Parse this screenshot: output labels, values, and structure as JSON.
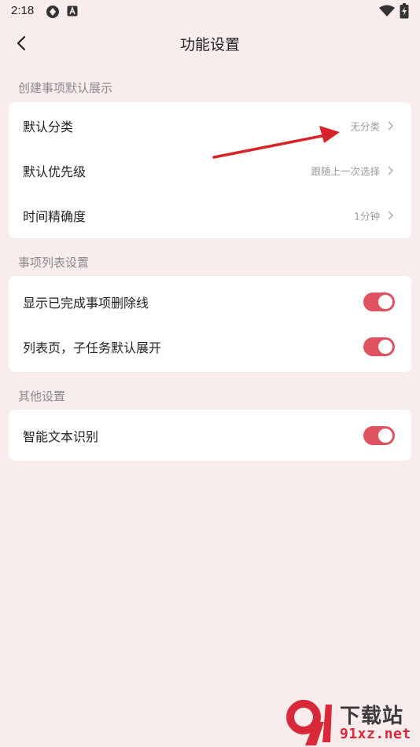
{
  "status_bar": {
    "time": "2:18",
    "icons": [
      "sync-icon",
      "a-badge-icon",
      "wifi-icon",
      "battery-charging-icon"
    ]
  },
  "header": {
    "title": "功能设置",
    "back_icon": "chevron-left-icon"
  },
  "sections": [
    {
      "title": "创建事项默认展示",
      "items": [
        {
          "label": "默认分类",
          "value": "无分类",
          "control": "chevron"
        },
        {
          "label": "默认优先级",
          "value": "跟随上一次选择",
          "control": "chevron"
        },
        {
          "label": "时间精确度",
          "value": "1分钟",
          "control": "chevron"
        }
      ]
    },
    {
      "title": "事项列表设置",
      "items": [
        {
          "label": "显示已完成事项删除线",
          "control": "toggle",
          "on": true
        },
        {
          "label": "列表页，子任务默认展开",
          "control": "toggle",
          "on": true
        }
      ]
    },
    {
      "title": "其他设置",
      "items": [
        {
          "label": "智能文本识别",
          "control": "toggle",
          "on": true
        }
      ]
    }
  ],
  "watermark": {
    "title": "下载站",
    "site": "91xz.net"
  },
  "colors": {
    "background": "#f9eced",
    "card": "#ffffff",
    "accent": "#e0525f",
    "annotation_arrow": "#d8232a"
  }
}
